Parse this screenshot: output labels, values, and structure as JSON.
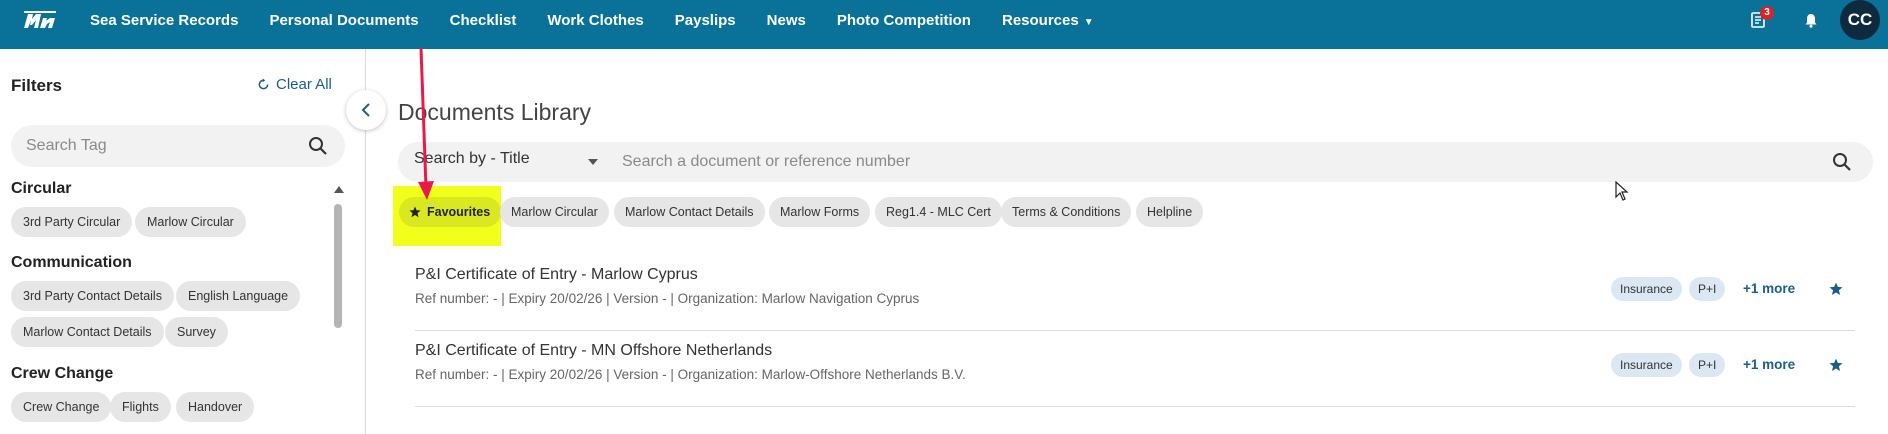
{
  "header": {
    "nav": [
      {
        "label": "Sea Service Records"
      },
      {
        "label": "Personal Documents"
      },
      {
        "label": "Checklist"
      },
      {
        "label": "Work Clothes"
      },
      {
        "label": "Payslips"
      },
      {
        "label": "News"
      },
      {
        "label": "Photo Competition"
      },
      {
        "label": "Resources"
      }
    ],
    "notification_count": "3",
    "avatar_initials": "CC",
    "bar_color": "#0a7199"
  },
  "sidebar": {
    "title": "Filters",
    "clear_all": "Clear All",
    "search_placeholder": "Search Tag",
    "sections": [
      {
        "title": "Circular",
        "tags": [
          "3rd Party Circular",
          "Marlow Circular"
        ]
      },
      {
        "title": "Communication",
        "tags": [
          "3rd Party Contact Details",
          "English Language",
          "Marlow Contact Details",
          "Survey"
        ]
      },
      {
        "title": "Crew Change",
        "tags": [
          "Crew Change",
          "Flights",
          "Handover"
        ]
      }
    ]
  },
  "main": {
    "title": "Documents Library",
    "search_by": "Search by - Title",
    "search_placeholder": "Search a document or reference number",
    "filter_chips": [
      "Favourites",
      "Marlow Circular",
      "Marlow Contact Details",
      "Marlow Forms",
      "Reg1.4 - MLC Cert",
      "Terms & Conditions",
      "Helpline"
    ],
    "documents": [
      {
        "title": "P&I Certificate of Entry - Marlow Cyprus",
        "meta": "Ref number: - | Expiry 20/02/26 | Version - | Organization: Marlow Navigation Cyprus",
        "tags": [
          "Insurance",
          "P+I"
        ],
        "more": "+1 more"
      },
      {
        "title": "P&I Certificate of Entry - MN Offshore Netherlands",
        "meta": "Ref number: - | Expiry 20/02/26 | Version - | Organization: Marlow-Offshore Netherlands B.V.",
        "tags": [
          "Insurance",
          "P+I"
        ],
        "more": "+1 more"
      }
    ]
  },
  "colors": {
    "accent": "#1a5f8a",
    "highlight": "#f2ff1a",
    "annotation_arrow": "#e8194b"
  }
}
